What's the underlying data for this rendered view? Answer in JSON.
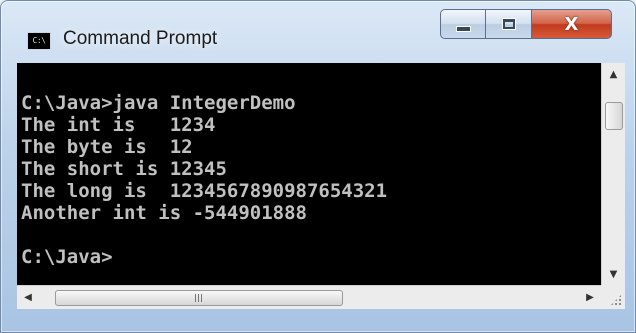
{
  "window": {
    "title": "Command Prompt",
    "icon_label": "C:\\",
    "icon": "console-icon",
    "close_glyph": "X"
  },
  "console": {
    "lines": [
      "C:\\Java>java IntegerDemo",
      "The int is   1234",
      "The byte is  12",
      "The short is 12345",
      "The long is  1234567890987654321",
      "Another int is -544901888",
      "",
      "C:\\Java>"
    ],
    "text_color": "#c0c0c0",
    "background": "#000000"
  },
  "scrollbars": {
    "up_arrow": "▲",
    "down_arrow": "▼",
    "left_arrow": "◀",
    "right_arrow": "▶"
  }
}
